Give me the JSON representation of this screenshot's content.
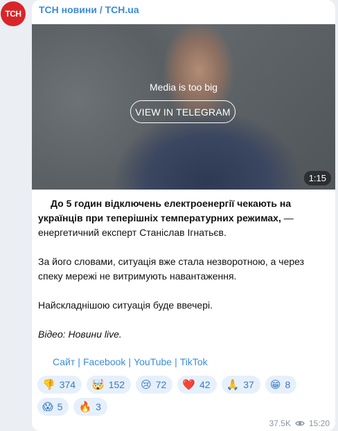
{
  "avatar": {
    "text": "ТСН",
    "color": "#d9252a"
  },
  "channel": {
    "name": "ТСН новини / TCH.ua"
  },
  "media": {
    "notice": "Media is too big",
    "button_label": "VIEW IN TELEGRAM",
    "duration": "1:15"
  },
  "post": {
    "bold_lead": "До 5 годин відключень електроенергії чекають на українців при теперішніх температурних режимах,",
    "lead_rest": " — енергетичний експерт Станіслав Ігнатьєв.",
    "p2": "За його словами, ситуація вже стала незворотною, а через спеку мережі не витримують навантаження.",
    "p3": "Найскладнішою ситуація буде ввечері.",
    "credit": "Відео: Новини live."
  },
  "links": [
    "Сайт",
    "Facebook",
    "YouTube",
    "TikTok"
  ],
  "link_separator": "|",
  "reactions": [
    {
      "icon": "thumbs-down-icon",
      "emoji": "👎",
      "count": "374"
    },
    {
      "icon": "exploding-head-icon",
      "emoji": "🤯",
      "count": "152"
    },
    {
      "icon": "crying-face-icon",
      "emoji": "😢",
      "count": "72"
    },
    {
      "icon": "heart-icon",
      "emoji": "❤️",
      "count": "42"
    },
    {
      "icon": "folded-hands-icon",
      "emoji": "🙏",
      "count": "37"
    },
    {
      "icon": "grimacing-smile-icon",
      "emoji": "😁",
      "count": "8"
    },
    {
      "icon": "screaming-face-icon",
      "emoji": "😱",
      "count": "5"
    },
    {
      "icon": "fire-icon",
      "emoji": "🔥",
      "count": "3"
    }
  ],
  "meta": {
    "views": "37.5K",
    "time": "15:20"
  },
  "colors": {
    "accent": "#3a8bd8",
    "background": "#ebeef3",
    "reaction_bg": "#e6f0fa"
  }
}
